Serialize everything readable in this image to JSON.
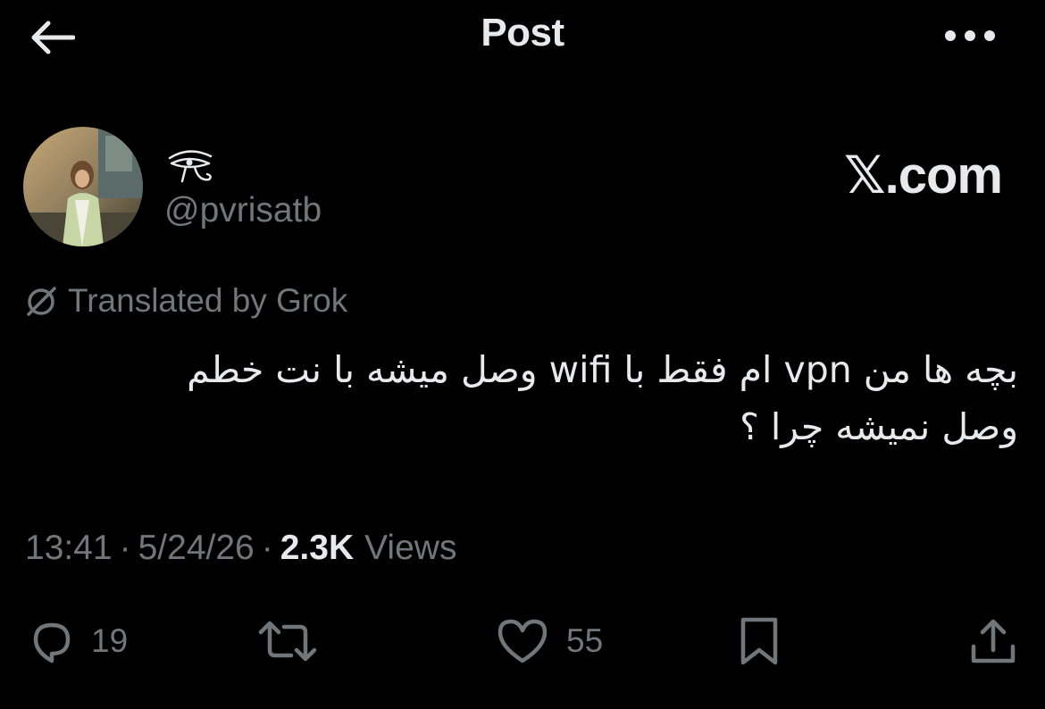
{
  "header": {
    "title": "Post",
    "back_icon": "arrow-left-icon",
    "more_icon": "ellipsis-icon"
  },
  "author": {
    "display_name_icon": "eye-glyph-icon",
    "handle": "@pvrisatb"
  },
  "watermark": "𝕏.com",
  "translation": {
    "icon": "translate-icon",
    "label": "Translated by Grok"
  },
  "post": {
    "text": "بچه ها من vpn ام فقط با wifi وصل میشه با نت خطم\nوصل نمیشه چرا ؟"
  },
  "meta": {
    "time": "13:41",
    "separator": "·",
    "date": "5/24/26",
    "views_count": "2.3K",
    "views_label": "Views"
  },
  "actions": {
    "reply": {
      "icon": "reply-icon",
      "count": "19"
    },
    "repost": {
      "icon": "repost-icon"
    },
    "like": {
      "icon": "heart-icon",
      "count": "55"
    },
    "bookmark": {
      "icon": "bookmark-icon"
    },
    "share": {
      "icon": "share-icon"
    }
  },
  "colors": {
    "background": "#000000",
    "text_primary": "#e7e9ea",
    "text_secondary": "#71767b"
  }
}
